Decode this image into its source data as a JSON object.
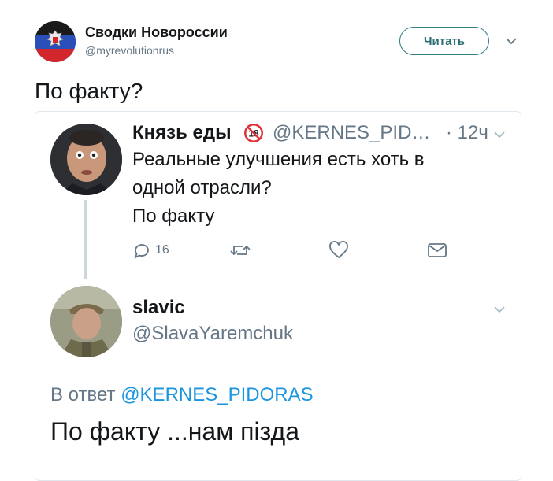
{
  "author": {
    "name": "Сводки Новороссии",
    "handle": "@myrevolutionrus",
    "follow_label": "Читать"
  },
  "tweet": {
    "text": "По факту?"
  },
  "quoted": {
    "name": "Князь еды",
    "badge": "18",
    "handle": "@KERNES_PID…",
    "time": "· 12ч",
    "lines": [
      "Реальные улучшения есть хоть в",
      "одной отрасли?",
      "По факту"
    ],
    "actions": {
      "reply_count": "16"
    }
  },
  "reply": {
    "name": "slavic",
    "handle": "@SlavaYaremchuk",
    "reply_prefix": "В ответ",
    "reply_mention": "@KERNES_PIDORAS",
    "text": "По факту ...нам пізда"
  },
  "colors": {
    "accent": "#1b95e0",
    "muted": "#657786",
    "follow_border": "#2f7f85"
  },
  "icons": [
    "chevron-down-icon",
    "reply-icon",
    "retweet-icon",
    "like-icon",
    "message-icon",
    "age-18-icon"
  ]
}
